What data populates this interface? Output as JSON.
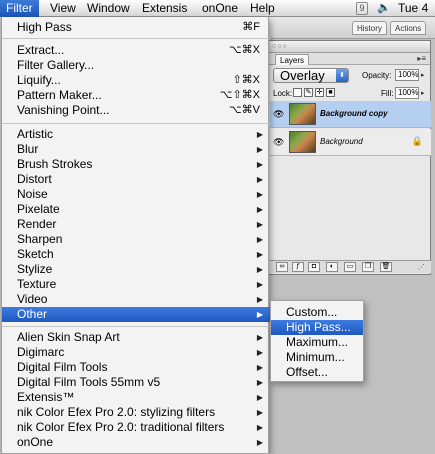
{
  "menubar": {
    "items": [
      "Filter",
      "View",
      "Window",
      "Extensis",
      "onOne",
      "Help"
    ],
    "active_index": 0,
    "clock": "Tue 4"
  },
  "filter_menu": {
    "last_filter": {
      "label": "High Pass",
      "shortcut": "⌘F"
    },
    "group1": [
      {
        "label": "Extract...",
        "shortcut": "⌥⌘X"
      },
      {
        "label": "Filter Gallery...",
        "shortcut": ""
      },
      {
        "label": "Liquify...",
        "shortcut": "⇧⌘X"
      },
      {
        "label": "Pattern Maker...",
        "shortcut": "⌥⇧⌘X"
      },
      {
        "label": "Vanishing Point...",
        "shortcut": "⌥⌘V"
      }
    ],
    "group2": [
      "Artistic",
      "Blur",
      "Brush Strokes",
      "Distort",
      "Noise",
      "Pixelate",
      "Render",
      "Sharpen",
      "Sketch",
      "Stylize",
      "Texture",
      "Video",
      "Other"
    ],
    "highlighted": "Other",
    "group3": [
      "Alien Skin Snap Art",
      "Digimarc",
      "Digital Film Tools",
      "Digital Film Tools 55mm v5",
      "Extensis™",
      "nik Color Efex Pro 2.0: stylizing filters",
      "nik Color Efex Pro 2.0: traditional filters",
      "onOne"
    ]
  },
  "other_submenu": {
    "items": [
      "Custom...",
      "High Pass...",
      "Maximum...",
      "Minimum...",
      "Offset..."
    ],
    "highlighted": "High Pass..."
  },
  "top_strip": {
    "tabs": [
      "History",
      "Actions"
    ]
  },
  "layers_palette": {
    "tab": "Layers",
    "blend_mode": "Overlay",
    "opacity_label": "Opacity:",
    "opacity": "100%",
    "lock_label": "Lock:",
    "fill_label": "Fill:",
    "fill": "100%",
    "layers": [
      {
        "name": "Background copy",
        "selected": true
      },
      {
        "name": "Background",
        "selected": false
      }
    ]
  },
  "colors": {
    "highlight": "#2a64cc",
    "menu_bg": "#f4f4f4",
    "selected_layer": "#b4cff0"
  }
}
